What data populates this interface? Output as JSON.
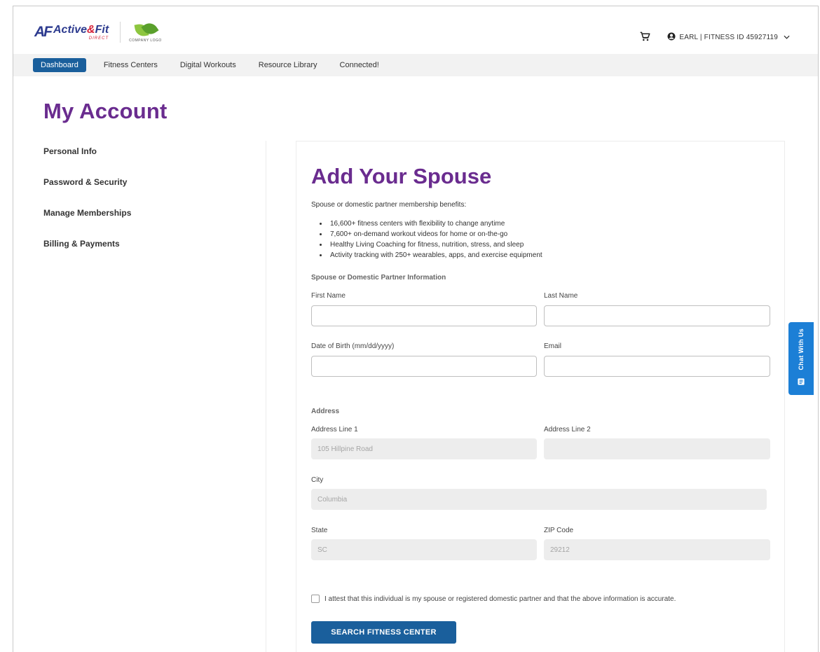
{
  "brand": {
    "mark": "AF",
    "name_part1": "Active",
    "name_amp": "&",
    "name_part2": "Fit",
    "subtitle": "DIRECT",
    "company_logo_text": "COMPANY LOGO"
  },
  "header": {
    "user_label": "EARL | FITNESS ID 45927119",
    "icons": [
      "cart-icon",
      "user-circle-icon",
      "chevron-down-icon"
    ]
  },
  "nav": {
    "items": [
      {
        "label": "Dashboard",
        "active": true
      },
      {
        "label": "Fitness Centers",
        "active": false
      },
      {
        "label": "Digital Workouts",
        "active": false
      },
      {
        "label": "Resource Library",
        "active": false
      },
      {
        "label": "Connected!",
        "active": false
      }
    ]
  },
  "page": {
    "title": "My Account"
  },
  "sidebar": {
    "items": [
      {
        "label": "Personal Info"
      },
      {
        "label": "Password & Security"
      },
      {
        "label": "Manage Memberships"
      },
      {
        "label": "Billing & Payments"
      }
    ]
  },
  "form": {
    "title": "Add Your Spouse",
    "intro": "Spouse or domestic partner membership benefits:",
    "benefits": [
      "16,600+ fitness centers with flexibility to change anytime",
      "7,600+ on-demand workout videos for home or on-the-go",
      "Healthy Living Coaching for fitness, nutrition, stress, and sleep",
      "Activity tracking with 250+ wearables, apps, and exercise equipment"
    ],
    "partner_section": "Spouse or Domestic Partner Information",
    "first_name": {
      "label": "First Name",
      "value": ""
    },
    "last_name": {
      "label": "Last Name",
      "value": ""
    },
    "dob": {
      "label": "Date of Birth (mm/dd/yyyy)",
      "value": ""
    },
    "email": {
      "label": "Email",
      "value": ""
    },
    "address_section": "Address",
    "address1": {
      "label": "Address Line 1",
      "value": "105 Hillpine Road"
    },
    "address2": {
      "label": "Address Line 2",
      "value": ""
    },
    "city": {
      "label": "City",
      "value": "Columbia"
    },
    "state": {
      "label": "State",
      "value": "SC"
    },
    "zip": {
      "label": "ZIP Code",
      "value": "29212"
    },
    "attest_text": "I attest that this individual is my spouse or registered domestic partner and that the above information is accurate.",
    "attest_checked": false,
    "submit_label": "SEARCH FITNESS CENTER"
  },
  "chat": {
    "label": "Chat With Us"
  },
  "colors": {
    "brand_purple": "#6a2c8f",
    "primary_blue": "#1a5f9c",
    "chat_blue": "#1c7fd6",
    "brand_navy": "#2d3b8f",
    "brand_red": "#d6243b"
  }
}
